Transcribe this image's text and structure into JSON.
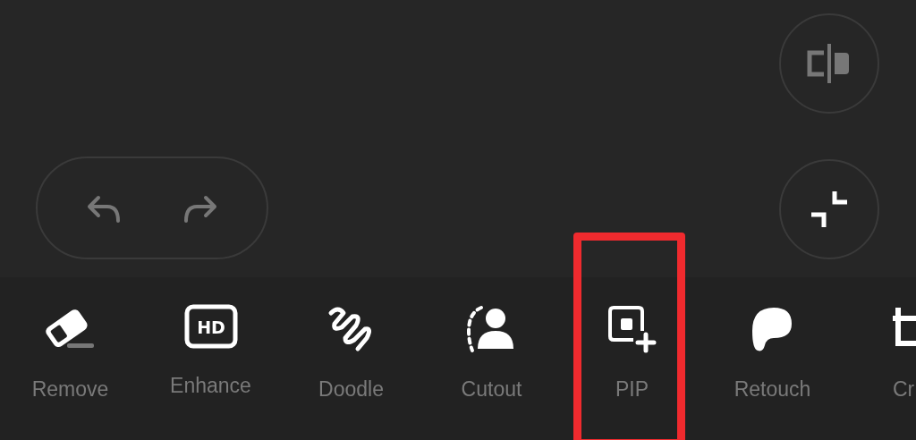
{
  "history": {
    "undo_disabled": true,
    "redo_disabled": true
  },
  "compare_button": {
    "disabled": true
  },
  "tools": [
    {
      "kind": "eraser",
      "label": "Remove",
      "highlighted": false
    },
    {
      "kind": "hd",
      "badge": "HD",
      "label": "Enhance",
      "highlighted": false
    },
    {
      "kind": "squiggle",
      "label": "Doodle",
      "highlighted": false
    },
    {
      "kind": "person",
      "label": "Cutout",
      "highlighted": false
    },
    {
      "kind": "pip",
      "label": "PIP",
      "highlighted": true
    },
    {
      "kind": "retouch",
      "label": "Retouch",
      "highlighted": false
    },
    {
      "kind": "crop",
      "label": "Cr",
      "highlighted": false
    }
  ]
}
